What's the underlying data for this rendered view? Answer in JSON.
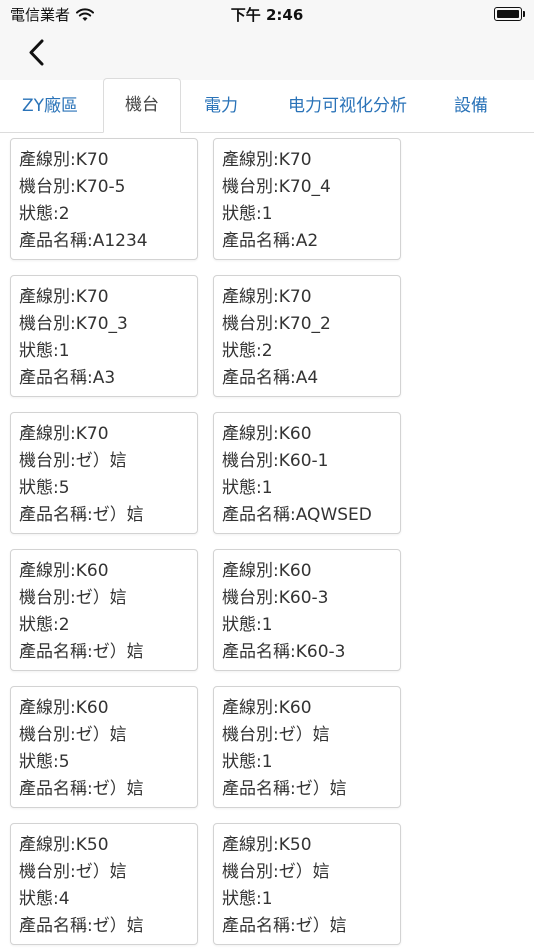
{
  "status": {
    "carrier": "電信業者",
    "time": "下午 2:46"
  },
  "tabs": [
    {
      "label": "ZY廠區"
    },
    {
      "label": "機台"
    },
    {
      "label": "電力"
    },
    {
      "label": "电力可视化分析"
    },
    {
      "label": "設備"
    }
  ],
  "cards": [
    {
      "line": "產線別:K70",
      "machine": "機台別:K70-5",
      "state": "狀態:2",
      "product": "產品名稱:A1234"
    },
    {
      "line": "產線別:K70",
      "machine": "機台別:K70_4",
      "state": "狀態:1",
      "product": "產品名稱:A2"
    },
    {
      "line": "產線別:K70",
      "machine": "機台別:K70_3",
      "state": "狀態:1",
      "product": "產品名稱:A3"
    },
    {
      "line": "產線別:K70",
      "machine": "機台別:K70_2",
      "state": "狀態:2",
      "product": "產品名稱:A4"
    },
    {
      "line": "產線別:K70",
      "machine": "機台別:ゼ）娮",
      "state": "狀態:5",
      "product": "產品名稱:ゼ）娮"
    },
    {
      "line": "產線別:K60",
      "machine": "機台別:K60-1",
      "state": "狀態:1",
      "product": "產品名稱:AQWSED"
    },
    {
      "line": "產線別:K60",
      "machine": "機台別:ゼ）娮",
      "state": "狀態:2",
      "product": "產品名稱:ゼ）娮"
    },
    {
      "line": "產線別:K60",
      "machine": "機台別:K60-3",
      "state": "狀態:1",
      "product": "產品名稱:K60-3"
    },
    {
      "line": "產線別:K60",
      "machine": "機台別:ゼ）娮",
      "state": "狀態:5",
      "product": "產品名稱:ゼ）娮"
    },
    {
      "line": "產線別:K60",
      "machine": "機台別:ゼ）娮",
      "state": "狀態:1",
      "product": "產品名稱:ゼ）娮"
    },
    {
      "line": "產線別:K50",
      "machine": "機台別:ゼ）娮",
      "state": "狀態:4",
      "product": "產品名稱:ゼ）娮"
    },
    {
      "line": "產線別:K50",
      "machine": "機台別:ゼ）娮",
      "state": "狀態:1",
      "product": "產品名稱:ゼ）娮"
    }
  ]
}
